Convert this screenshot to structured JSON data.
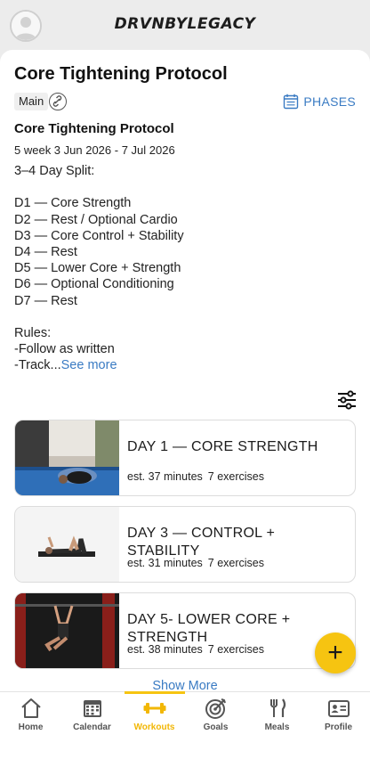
{
  "header": {
    "brand": "DRVNBYLEGACY"
  },
  "program": {
    "title": "Core Tightening Protocol",
    "tag": "Main",
    "phases_label": "PHASES",
    "subtitle": "Core Tightening Protocol",
    "dates": "5 week 3 Jun 2026 - 7 Jul 2026",
    "description_lines": [
      "3–4 Day Split:",
      "",
      "D1 — Core Strength",
      "D2 — Rest / Optional Cardio",
      "D3 — Core Control + Stability",
      "D4 — Rest",
      "D5 — Lower Core + Strength",
      "D6 — Optional Conditioning",
      "D7 — Rest",
      "",
      "Rules:",
      "-Follow as written",
      "-Track..."
    ],
    "see_more": "See more"
  },
  "workouts": [
    {
      "name": "DAY 1 — CORE STRENGTH",
      "duration": "est. 37 minutes",
      "exercises": "7 exercises"
    },
    {
      "name": "DAY 3 — CONTROL + STABILITY",
      "duration": "est. 31 minutes",
      "exercises": "7 exercises"
    },
    {
      "name": "DAY 5- LOWER CORE + STRENGTH",
      "duration": "est. 38 minutes",
      "exercises": "7 exercises"
    }
  ],
  "show_more": "Show More",
  "fab_label": "+",
  "tabs": [
    {
      "label": "Home",
      "icon": "home-icon",
      "active": false
    },
    {
      "label": "Calendar",
      "icon": "calendar-icon",
      "active": false
    },
    {
      "label": "Workouts",
      "icon": "dumbbell-icon",
      "active": true
    },
    {
      "label": "Goals",
      "icon": "target-icon",
      "active": false
    },
    {
      "label": "Meals",
      "icon": "fork-knife-icon",
      "active": false
    },
    {
      "label": "Profile",
      "icon": "id-card-icon",
      "active": false
    }
  ],
  "colors": {
    "accent": "#f6c411",
    "link": "#3a7bc3",
    "tab_active": "#f2b705"
  }
}
